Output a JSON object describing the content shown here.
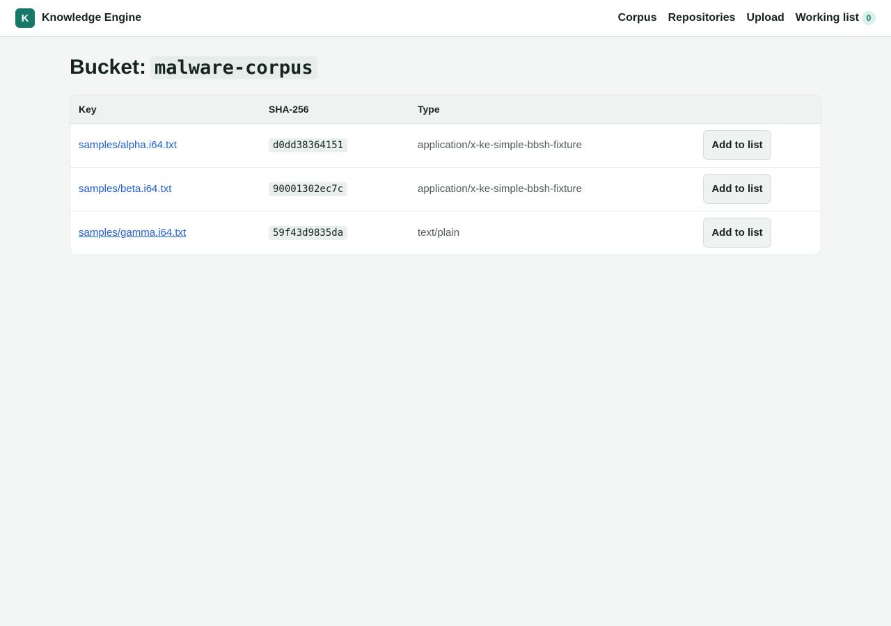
{
  "brand": {
    "logo_letter": "K",
    "name": "Knowledge Engine",
    "logo_color": "#17786a"
  },
  "nav": {
    "items": [
      "Corpus",
      "Repositories",
      "Upload"
    ],
    "working_list": {
      "label": "Working list",
      "count": "0"
    }
  },
  "page": {
    "title_prefix": "Bucket:",
    "bucket_name": "malware-corpus"
  },
  "table": {
    "headers": [
      "Key",
      "SHA-256",
      "Type",
      ""
    ],
    "rows": [
      {
        "key": "samples/alpha.i64.txt",
        "sha": "d0dd38364151",
        "type": "application/x-ke-simple-bbsh-fixture",
        "action": "Add to list"
      },
      {
        "key": "samples/beta.i64.txt",
        "sha": "90001302ec7c",
        "type": "application/x-ke-simple-bbsh-fixture",
        "action": "Add to list"
      },
      {
        "key": "samples/gamma.i64.txt",
        "sha": "59f43d9835da",
        "type": "text/plain",
        "action": "Add to list"
      }
    ]
  },
  "colors": {
    "link": "#1f5fd6",
    "accent": "#17786a",
    "background": "#f3f6f5"
  }
}
